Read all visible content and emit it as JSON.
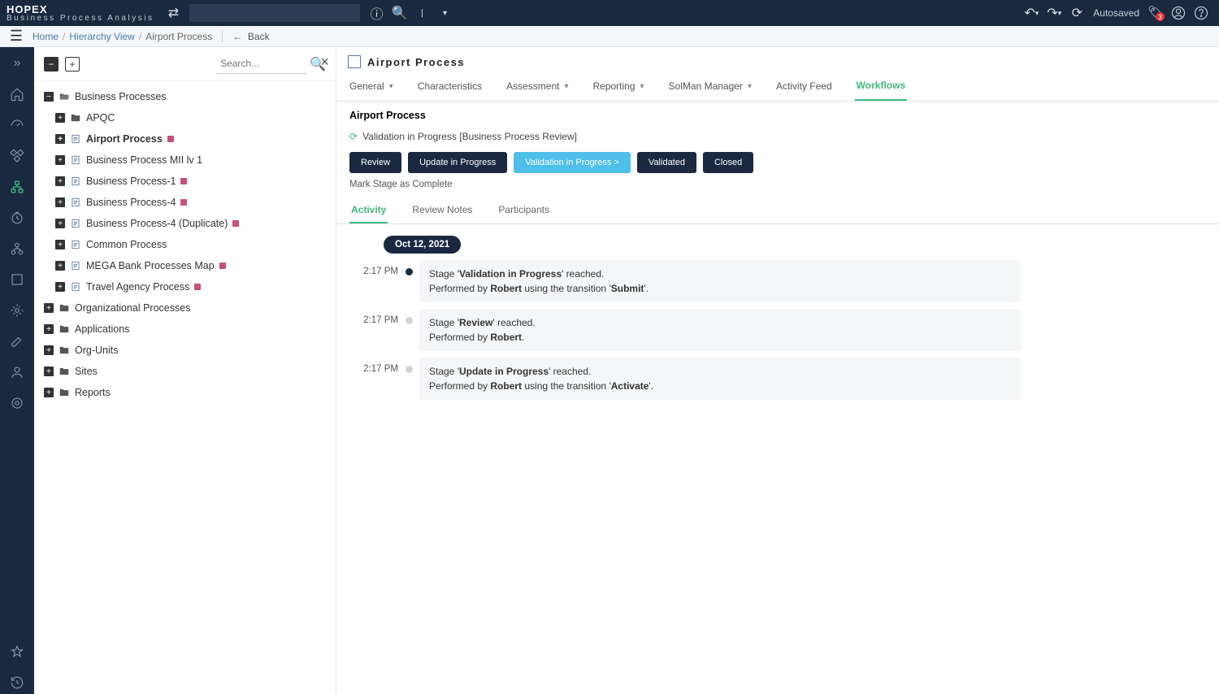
{
  "brand": {
    "title": "HOPEX",
    "subtitle": "Business Process Analysis"
  },
  "top": {
    "autosaved": "Autosaved",
    "notification_count": "3",
    "search_placeholder": ""
  },
  "breadcrumb": {
    "home": "Home",
    "hierarchy": "Hierarchy View",
    "current": "Airport Process",
    "back": "Back"
  },
  "tree": {
    "search_placeholder": "Search...",
    "root": "Business Processes",
    "children": [
      {
        "label": "APQC",
        "type": "folder"
      },
      {
        "label": "Airport Process",
        "type": "doc",
        "selected": true,
        "badge": true
      },
      {
        "label": "Business Process MII lv 1",
        "type": "doc"
      },
      {
        "label": "Business Process-1",
        "type": "doc",
        "badge": true
      },
      {
        "label": "Business Process-4",
        "type": "doc",
        "badge": true
      },
      {
        "label": "Business Process-4 (Duplicate)",
        "type": "doc",
        "badge": true
      },
      {
        "label": "Common Process",
        "type": "doc"
      },
      {
        "label": "MEGA Bank Processes Map",
        "type": "doc",
        "badge": true
      },
      {
        "label": "Travel Agency Process",
        "type": "doc",
        "badge": true
      }
    ],
    "siblings": [
      {
        "label": "Organizational Processes"
      },
      {
        "label": "Applications"
      },
      {
        "label": "Org-Units"
      },
      {
        "label": "Sites"
      },
      {
        "label": "Reports"
      }
    ]
  },
  "content": {
    "title": "Airport Process",
    "tabs": [
      "General",
      "Characteristics",
      "Assessment",
      "Reporting",
      "SolMan Manager",
      "Activity Feed",
      "Workflows"
    ],
    "active_tab": "Workflows",
    "sub_title": "Airport Process",
    "workflow_status": "Validation in Progress [Business Process Review]",
    "stages": [
      "Review",
      "Update in Progress",
      "Validation in Progress >",
      "Validated",
      "Closed"
    ],
    "current_stage_index": 2,
    "mark_complete": "Mark Stage as Complete",
    "subtabs": [
      "Activity",
      "Review Notes",
      "Participants"
    ],
    "active_subtab": "Activity",
    "date": "Oct 12, 2021",
    "entries": [
      {
        "time": "2:17 PM",
        "active": true,
        "stage": "Validation in Progress",
        "user": "Robert",
        "transition": "Submit"
      },
      {
        "time": "2:17 PM",
        "active": false,
        "stage": "Review",
        "user": "Robert",
        "transition": null
      },
      {
        "time": "2:17 PM",
        "active": false,
        "stage": "Update in Progress",
        "user": "Robert",
        "transition": "Activate"
      }
    ]
  }
}
